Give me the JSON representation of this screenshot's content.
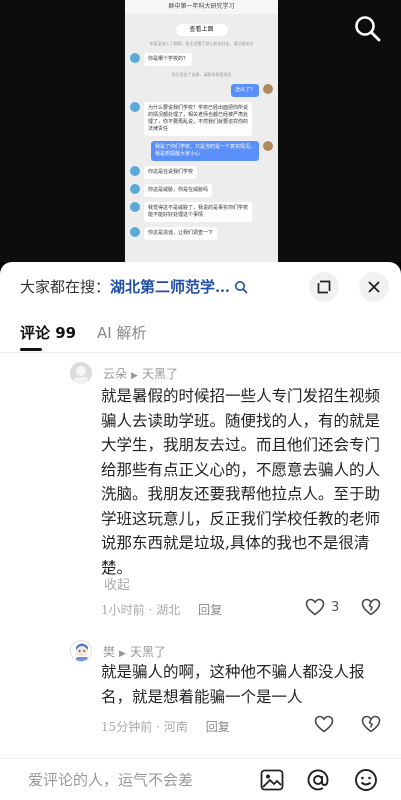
{
  "video": {
    "chat_title": "群中第一年科大研究学习",
    "more_button": "查看上面",
    "system_notes": [
      "李某某加入了群聊，群主设置了禁止私加好友，请注意安全",
      "你已添加了该群，请联系群管理员"
    ],
    "messages": [
      {
        "side": "left",
        "text": "你是哪个学校的？"
      },
      {
        "side": "right",
        "text": "怎么了？"
      },
      {
        "side": "left",
        "text": "为什么要说我们学校？学校已经出面把你所说的情况都处理了，相关老师也都已经被严肃处理了，你不要再乱说，不然我们就要追究你的法律责任"
      },
      {
        "side": "left",
        "text": "我是了你们学校，只是当时是一个真实情况，我是想提醒大家小心"
      },
      {
        "side": "right",
        "text": "你这是在说我们学校"
      },
      {
        "side": "left",
        "text": "你这是威胁，你是在威胁吗"
      },
      {
        "side": "right",
        "text": "我觉得这不是威胁了，我说的是事实你们学校能不能好好处理这个事情"
      },
      {
        "side": "left",
        "text": "你这是造谣，让我们调查一下"
      }
    ]
  },
  "sheet": {
    "search_prefix": "大家都在搜：",
    "search_term": "湖北第二师范学…"
  },
  "tabs": [
    {
      "label": "评论 99",
      "active": true
    },
    {
      "label": "AI 解析",
      "active": false
    }
  ],
  "comments": [
    {
      "user": "云朵",
      "reply_to": "天黑了",
      "text": "就是暑假的时候招一些人专门发招生视频骗人去读助学班。随便找的人，有的就是大学生，我朋友去过。而且他们还会专门给那些有点正义心的，不愿意去骗人的人洗脑。我朋友还要我帮他拉点人。至于助学班这玩意儿，反正我们学校任教的老师说那东西就是垃圾,具体的我也不是很清楚。",
      "fold": "收起",
      "time": "1小时前",
      "location": "湖北",
      "reply": "回复",
      "likes": "3"
    },
    {
      "user": "樊",
      "reply_to": "天黑了",
      "text": "就是骗人的啊，这种他不骗人都没人报名，就是想着能骗一个是一人",
      "time": "15分钟前",
      "location": "河南",
      "reply": "回复",
      "likes": ""
    }
  ],
  "input": {
    "placeholder": "爱评论的人，运气不会差"
  }
}
